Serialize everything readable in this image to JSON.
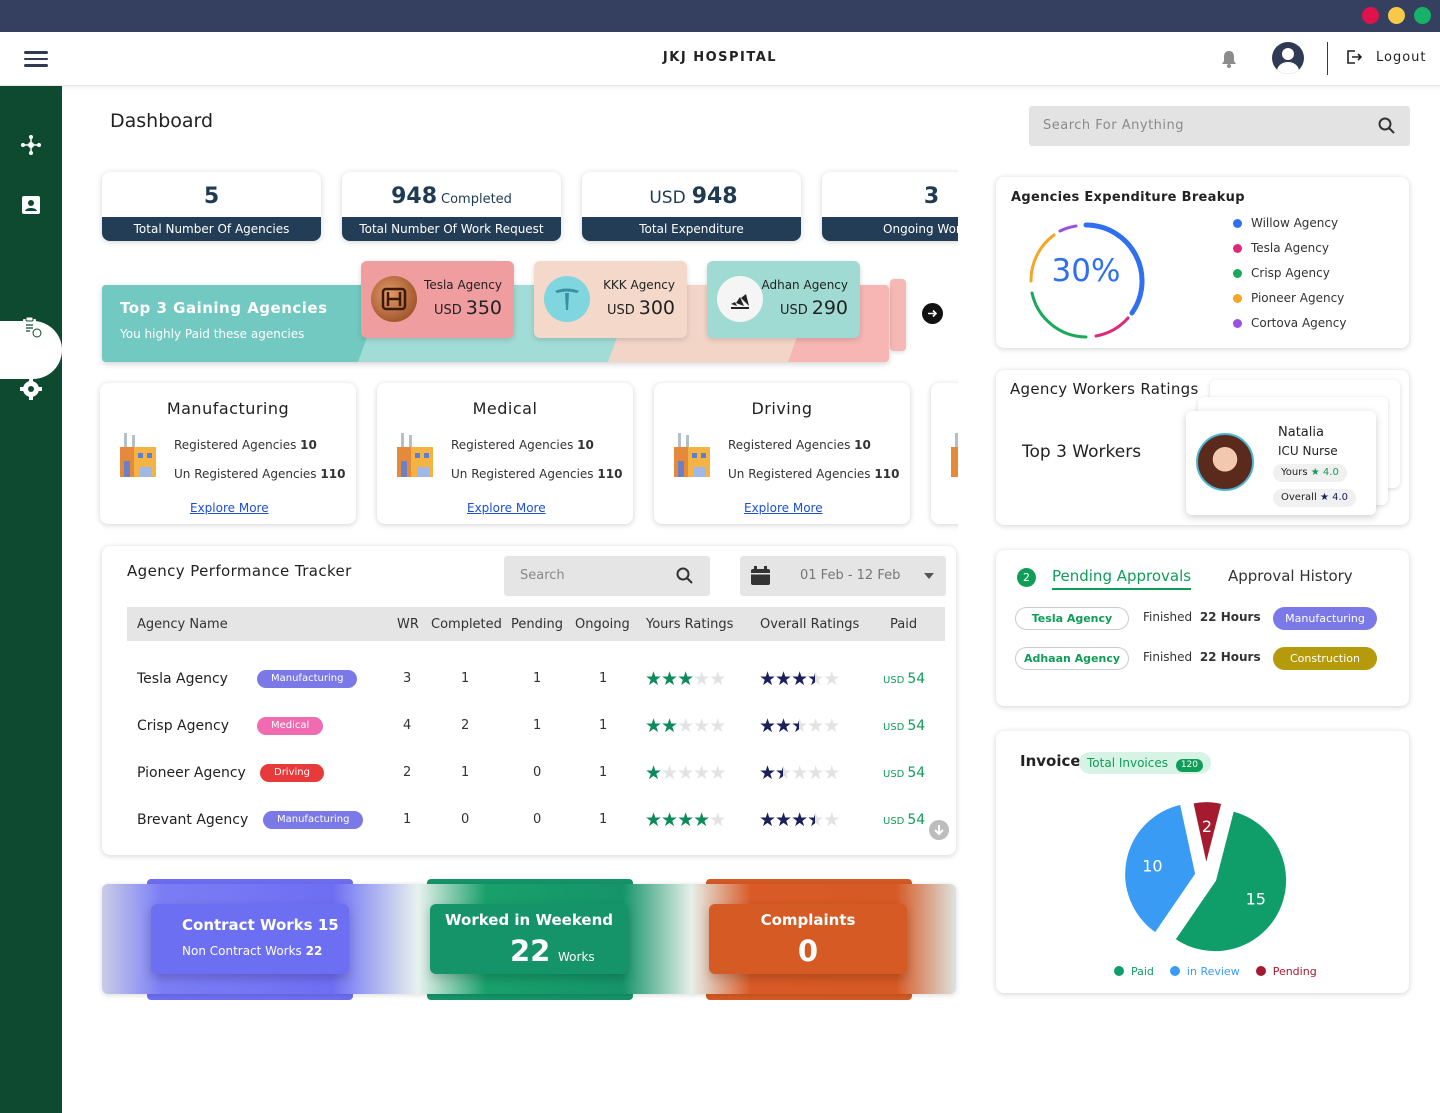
{
  "app": {
    "title": "JKJ HOSPITAL",
    "logout": "Logout"
  },
  "page": {
    "title": "Dashboard",
    "search_placeholder": "Search For Anything"
  },
  "stats": [
    {
      "value": "5",
      "suffix": "",
      "prefix": "",
      "label": "Total Number Of Agencies"
    },
    {
      "value": "948",
      "suffix": "Completed",
      "prefix": "",
      "label": "Total Number Of Work Request"
    },
    {
      "value": "948",
      "suffix": "",
      "prefix": "USD",
      "label": "Total Expenditure"
    },
    {
      "value": "3",
      "suffix": "",
      "prefix": "",
      "label": "Ongoing Work R"
    }
  ],
  "gaining": {
    "title": "Top 3 Gaining Agencies",
    "subtitle": "You highly Paid these agencies",
    "agencies": [
      {
        "name": "Tesla Agency",
        "currency": "USD",
        "amount": "350"
      },
      {
        "name": "KKK Agency",
        "currency": "USD",
        "amount": "300"
      },
      {
        "name": "Adhan Agency",
        "currency": "USD",
        "amount": "290"
      }
    ]
  },
  "categories": [
    {
      "title": "Manufacturing",
      "reg_label": "Registered Agencies",
      "reg": "10",
      "unreg_label": "Un Registered Agencies",
      "unreg": "110",
      "link": "Explore More"
    },
    {
      "title": "Medical",
      "reg_label": "Registered Agencies",
      "reg": "10",
      "unreg_label": "Un Registered Agencies",
      "unreg": "110",
      "link": "Explore More"
    },
    {
      "title": "Driving",
      "reg_label": "Registered Agencies",
      "reg": "10",
      "unreg_label": "Un Registered Agencies",
      "unreg": "110",
      "link": "Explore More"
    }
  ],
  "tracker": {
    "title": "Agency Performance Tracker",
    "search_placeholder": "Search",
    "date_range": "01 Feb - 12 Feb",
    "columns": [
      "Agency Name",
      "WR",
      "Completed",
      "Pending",
      "Ongoing",
      "Yours Ratings",
      "Overall Ratings",
      "Paid"
    ],
    "rows": [
      {
        "name": "Tesla Agency",
        "tag": "Manufacturing",
        "tag_color": "#7b79e8",
        "wr": "3",
        "completed": "1",
        "pending": "1",
        "ongoing": "1",
        "yours": 3,
        "overall": 3.5,
        "currency": "USD",
        "paid": "54"
      },
      {
        "name": "Crisp Agency",
        "tag": "Medical",
        "tag_color": "#f06bb0",
        "wr": "4",
        "completed": "2",
        "pending": "1",
        "ongoing": "1",
        "yours": 2,
        "overall": 2.5,
        "currency": "USD",
        "paid": "54"
      },
      {
        "name": "Pioneer Agency",
        "tag": "Driving",
        "tag_color": "#e83a3a",
        "wr": "2",
        "completed": "1",
        "pending": "0",
        "ongoing": "1",
        "yours": 1,
        "overall": 1.5,
        "currency": "USD",
        "paid": "54"
      },
      {
        "name": "Brevant Agency",
        "tag": "Manufacturing",
        "tag_color": "#7b79e8",
        "wr": "1",
        "completed": "0",
        "pending": "0",
        "ongoing": "1",
        "yours": 4,
        "overall": 3.5,
        "currency": "USD",
        "paid": "54"
      }
    ]
  },
  "bottom": {
    "contract": {
      "label": "Contract Works",
      "value": "15",
      "sub_label": "Non Contract Works",
      "sub_value": "22"
    },
    "weekend": {
      "label": "Worked in Weekend",
      "value": "22",
      "unit": "Works"
    },
    "complaints": {
      "label": "Complaints",
      "value": "0"
    }
  },
  "expenditure": {
    "title": "Agencies Expenditure Breakup",
    "percent": "30%",
    "legend": [
      {
        "name": "Willow Agency",
        "color": "#2f6ff0"
      },
      {
        "name": "Tesla Agency",
        "color": "#e0287a"
      },
      {
        "name": "Crisp Agency",
        "color": "#1aa85a"
      },
      {
        "name": "Pioneer Agency",
        "color": "#f5a623"
      },
      {
        "name": "Cortova Agency",
        "color": "#9b51e0"
      }
    ]
  },
  "ratings": {
    "title": "Agency Workers Ratings",
    "subtitle": "Top 3 Workers",
    "worker": {
      "name": "Natalia",
      "role": "ICU Nurse",
      "yours_label": "Yours",
      "yours": "4.0",
      "overall_label": "Overall",
      "overall": "4.0"
    }
  },
  "approvals": {
    "count": "2",
    "tab_active": "Pending Approvals",
    "tab_other": "Approval History",
    "rows": [
      {
        "agency": "Tesla Agency",
        "status": "Finished",
        "hours": "22 Hours",
        "tag": "Manufacturing",
        "tag_color": "#7b79e8"
      },
      {
        "agency": "Adhaan Agency",
        "status": "Finished",
        "hours": "22 Hours",
        "tag": "Construction",
        "tag_color": "#b59a0b"
      }
    ]
  },
  "invoice": {
    "title": "Invoice",
    "total_label": "Total Invoices",
    "total": "120",
    "legend": [
      {
        "name": "Paid",
        "color": "#0f9d69"
      },
      {
        "name": "in Review",
        "color": "#3a9bf4"
      },
      {
        "name": "Pending",
        "color": "#a51a2e"
      }
    ]
  },
  "chart_data": {
    "type": "pie",
    "categories": [
      "Paid",
      "in Review",
      "Pending"
    ],
    "values": [
      15,
      10,
      2
    ],
    "colors": [
      "#0f9d69",
      "#3a9bf4",
      "#a51a2e"
    ],
    "title": "Invoice"
  }
}
